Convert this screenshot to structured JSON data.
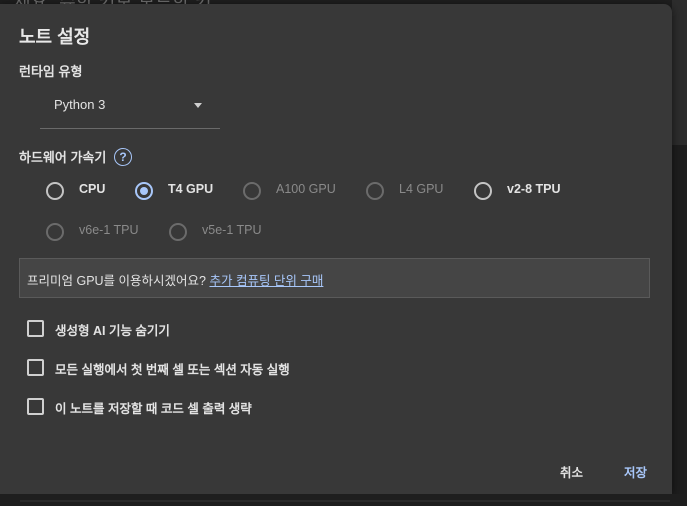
{
  "background": {
    "top_text": "세요. 슈한 키보 모드한 키"
  },
  "dialog": {
    "title": "노트 설정",
    "runtime": {
      "label": "런타임 유형",
      "selected": "Python 3"
    },
    "accelerator": {
      "label": "하드웨어 가속기",
      "help_icon": "?",
      "options": [
        {
          "label": "CPU",
          "checked": false,
          "disabled": false
        },
        {
          "label": "T4 GPU",
          "checked": true,
          "disabled": false
        },
        {
          "label": "A100 GPU",
          "checked": false,
          "disabled": true
        },
        {
          "label": "L4 GPU",
          "checked": false,
          "disabled": true
        },
        {
          "label": "v2-8 TPU",
          "checked": false,
          "disabled": false
        },
        {
          "label": "v6e-1 TPU",
          "checked": false,
          "disabled": true
        },
        {
          "label": "v5e-1 TPU",
          "checked": false,
          "disabled": true
        }
      ]
    },
    "promo": {
      "text": "프리미엄 GPU를 이용하시겠어요? ",
      "link": "추가 컴퓨팅 단위 구매"
    },
    "checkboxes": [
      {
        "label": "생성형 AI 기능 숨기기",
        "checked": false
      },
      {
        "label": "모든 실행에서 첫 번째 셀 또는 섹션 자동 실행",
        "checked": false
      },
      {
        "label": "이 노트를 저장할 때 코드 셀 출력 생략",
        "checked": false
      }
    ],
    "buttons": {
      "cancel": "취소",
      "save": "저장"
    }
  },
  "colors": {
    "accent": "#a8c7fa",
    "dialog_bg": "#383838"
  }
}
